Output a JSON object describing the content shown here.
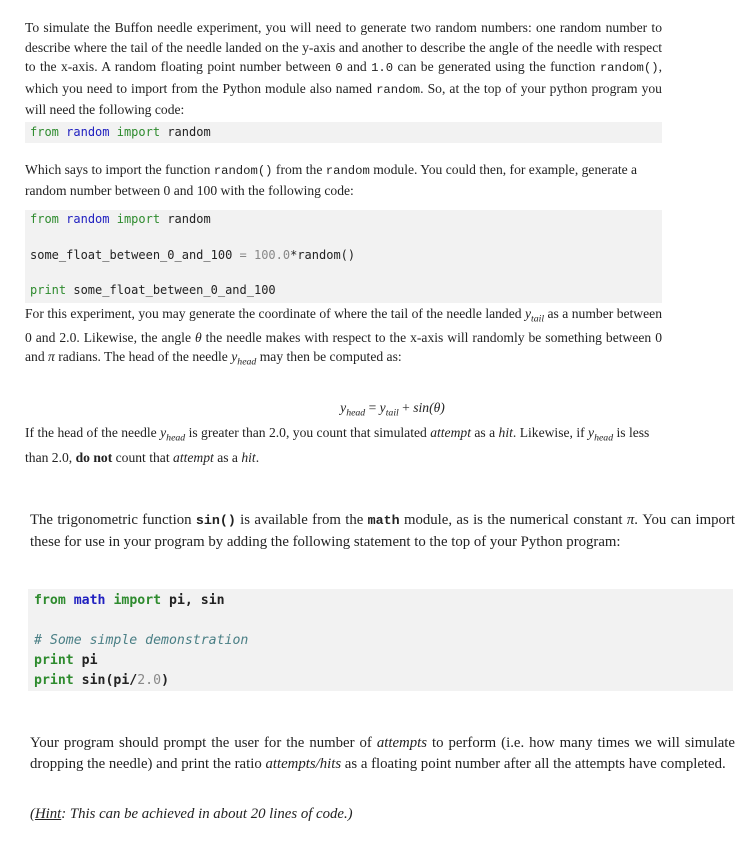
{
  "intro": {
    "text_a": "To simulate the Buffon needle experiment, you will need to generate two random numbers: one random number to describe where the tail of the needle landed on the y-axis and another to describe the angle of the needle with respect to the x-axis. A random floating point number between ",
    "code_zero": "0",
    "text_b": " and ",
    "code_one": "1.0",
    "text_c": " can be generated using the function ",
    "code_random_fn": "random()",
    "text_d": ", which you need to import from the Python module also named ",
    "code_random_mod": "random",
    "text_e": ". So, at the top of your python program you will need the following code:"
  },
  "code_block_1": {
    "kw_from": "from",
    "module": "random",
    "kw_import": "import",
    "name": "random"
  },
  "explain": {
    "text_a": "Which says to import the function ",
    "code_fn": "random()",
    "text_b": " from the ",
    "code_mod": "random",
    "text_c": " module. You could then, for example, generate a random number between 0 and 100 with the following code:"
  },
  "code_block_2": {
    "line1": {
      "kw_from": "from",
      "module": "random",
      "kw_import": "import",
      "name": "random"
    },
    "line2": {
      "var": "some_float_between_0_and_100",
      "op": " = ",
      "num": "100.0",
      "rest": "*random()"
    },
    "line3": {
      "kw_print": "print",
      "arg": " some_float_between_0_and_100"
    }
  },
  "experiment": {
    "text_a": "For this experiment, you may generate the coordinate of where the tail of the needle landed ",
    "y_tail": "y",
    "y_tail_sub": "tail",
    "text_b": " as a number between 0 and 2.0. Likewise, the angle ",
    "theta": "θ",
    "text_c": " the needle makes with respect to the x-axis will randomly be something between 0 and ",
    "pi": "π",
    "text_d": " radians. The head of the needle ",
    "y_head": "y",
    "y_head_sub": "head",
    "text_e": " may then be computed as:"
  },
  "equation": {
    "lhs": "y",
    "lhs_sub": "head",
    "eq": " = ",
    "rhs": "y",
    "rhs_sub": "tail",
    "plus": " + ",
    "fn": "sin(θ)"
  },
  "rule": {
    "text_a": "If the head of the needle ",
    "y": "y",
    "y_sub": "head",
    "text_b": " is greater than 2.0, you count that simulated ",
    "attempt": "attempt",
    "text_c": " as a ",
    "hit": "hit",
    "text_d": ". Likewise, if ",
    "text_e": " is less than 2.0, ",
    "do_not": "do not",
    "text_f": " count that ",
    "text_g": " as a ",
    "end": "."
  },
  "trig": {
    "text_a": "The trigonometric function ",
    "code_sin": "sin()",
    "text_b": " is available from the ",
    "code_math": "math",
    "text_c": " module, as is the numerical constant ",
    "pi": "π",
    "text_d": ". You can import these for use in your program by adding the following statement to the top of your Python program:"
  },
  "code_block_3": {
    "line1": {
      "kw_from": "from",
      "module": "math",
      "kw_import": "import",
      "names": " pi, sin"
    },
    "comment": "# Some simple demonstration",
    "line3": {
      "kw_print": "print",
      "arg": " pi"
    },
    "line4": {
      "kw_print": "print",
      "arg_a": " sin(pi/",
      "num": "2.0",
      "arg_b": ")"
    }
  },
  "task": {
    "text_a": "Your program should prompt the user for the number of ",
    "attempts": "attempts",
    "text_b": " to perform (i.e. how many times we will simulate dropping the needle) and print the ratio ",
    "ratio": "attempts/hits",
    "text_c": " as a floating point number after all the attempts have completed."
  },
  "hint": {
    "open": "(",
    "label": "Hint",
    "text": ": This can be achieved in about 20 lines of code.)"
  }
}
